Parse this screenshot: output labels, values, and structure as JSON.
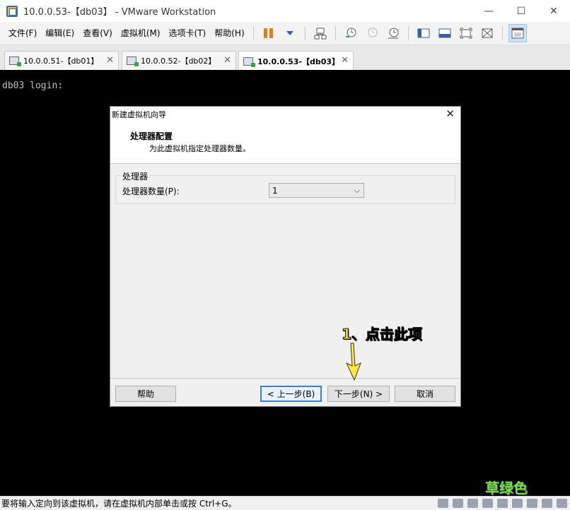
{
  "window": {
    "title": "10.0.0.53-【db03】 - VMware Workstation",
    "minimize_glyph": "—",
    "maximize_glyph": "☐",
    "close_glyph": "✕"
  },
  "menu": [
    "文件(F)",
    "编辑(E)",
    "查看(V)",
    "虚拟机(M)",
    "选项卡(T)",
    "帮助(H)"
  ],
  "tabs": [
    {
      "label": "10.0.0.51-【db01】",
      "close": "✕"
    },
    {
      "label": "10.0.0.52-【db02】",
      "close": "✕"
    },
    {
      "label": "10.0.0.53-【db03】",
      "close": "✕"
    }
  ],
  "console": {
    "text": "db03 login:"
  },
  "dialog": {
    "title": "新建虚拟机向导",
    "close": "✕",
    "header_title": "处理器配置",
    "header_subtitle": "为此虚拟机指定处理器数量。",
    "group_label": "处理器",
    "field_label": "处理器数量(P):",
    "select_value": "1",
    "buttons": {
      "help": "帮助",
      "back": "< 上一步(B)",
      "next": "下一步(N) >",
      "cancel": "取消"
    }
  },
  "annotation": "1、点击此项",
  "watermark": "草绿色",
  "statusbar": {
    "text": "要将输入定向到该虚拟机，请在虚拟机内部单击或按 Ctrl+G。"
  },
  "colors": {
    "annotation": "#ffeb3b",
    "console_bg": "#000000",
    "accent": "#3c7fd1"
  }
}
